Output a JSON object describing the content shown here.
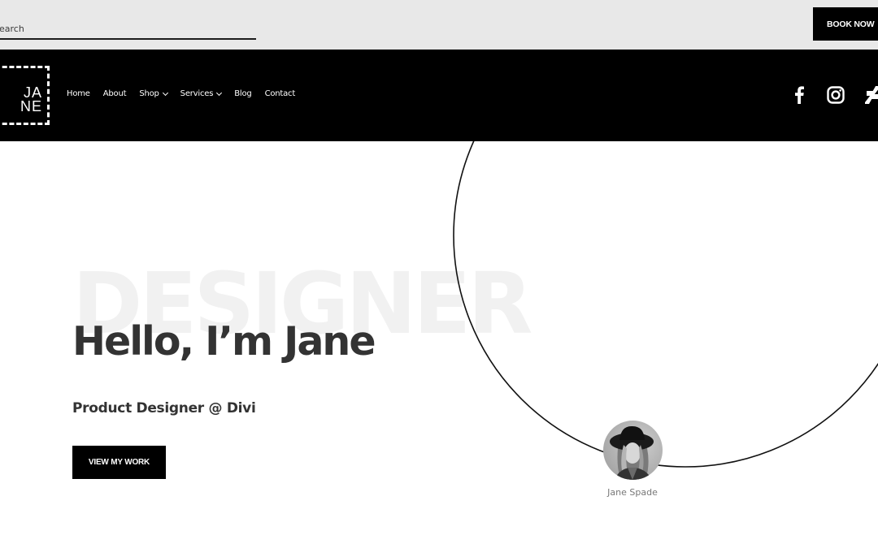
{
  "topbar": {
    "search_placeholder": "Search",
    "book_label": "BOOK NOW"
  },
  "navbar": {
    "logo_line1": "JA",
    "logo_line2": "NE",
    "items": [
      {
        "label": "Home",
        "has_dropdown": false
      },
      {
        "label": "About",
        "has_dropdown": false
      },
      {
        "label": "Shop",
        "has_dropdown": true
      },
      {
        "label": "Services",
        "has_dropdown": true
      },
      {
        "label": "Blog",
        "has_dropdown": false
      },
      {
        "label": "Contact",
        "has_dropdown": false
      }
    ],
    "social": [
      "facebook-icon",
      "instagram-icon",
      "deviantart-icon"
    ]
  },
  "hero": {
    "background_word": "DESIGNER",
    "title": "Hello, I’m Jane",
    "subtitle": "Product Designer @ Divi",
    "cta_label": "VIEW MY WORK",
    "avatar_name": "Jane Spade"
  },
  "colors": {
    "topbar_bg": "#e8e8e8",
    "navbar_bg": "#000000",
    "text_dark": "#333333",
    "bg_word": "#f1f1f1",
    "muted": "#777777"
  }
}
